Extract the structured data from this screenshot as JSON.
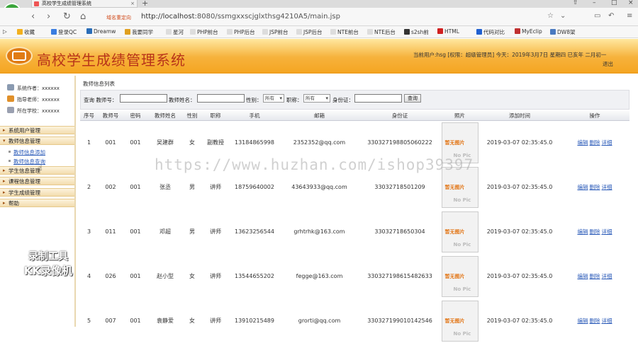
{
  "browser": {
    "tab_title": "高校学生成绩管理系统",
    "url_badge": "域名重定向",
    "url_host": "http://localhost",
    "url_path": ":8080/ssmgxxscjglxthsg4210A5/main.jsp",
    "bookmarks": [
      {
        "label": "收藏",
        "color": "#f2b01e"
      },
      {
        "label": "登录QC",
        "color": "#3a7de0"
      },
      {
        "label": "Dreamw",
        "color": "#2a6db8"
      },
      {
        "label": "我要同学",
        "color": "#e0a020"
      },
      {
        "label": "星河",
        "color": "#dddddd"
      },
      {
        "label": "PHP前台",
        "color": "#dddddd"
      },
      {
        "label": "PHP后台",
        "color": "#dddddd"
      },
      {
        "label": "JSP前台",
        "color": "#dddddd"
      },
      {
        "label": "JSP后台",
        "color": "#dddddd"
      },
      {
        "label": "NTE前台",
        "color": "#dddddd"
      },
      {
        "label": "NTE后台",
        "color": "#dddddd"
      },
      {
        "label": "s2sh前",
        "color": "#333333"
      },
      {
        "label": "HTML",
        "color": "#d02020"
      },
      {
        "label": "代码对比",
        "color": "#2060d0"
      },
      {
        "label": "MyEclip",
        "color": "#c03030"
      },
      {
        "label": "DW8架",
        "color": "#4a7ac0"
      }
    ]
  },
  "header": {
    "title": "高校学生成绩管理系统",
    "status": "当前用户:hsg [权限：超级管理员] 今天：2019年3月7日 星期四 已亥年 二月初一",
    "logout": "退出"
  },
  "sidebar": {
    "info": [
      {
        "label": "系统作者：xxxxxx",
        "color": "#8a9ab0"
      },
      {
        "label": "指导老师：xxxxxx",
        "color": "#e0902a"
      },
      {
        "label": "所在学校：xxxxxx",
        "color": "#9aa0b0"
      }
    ],
    "menus": {
      "m1": "系统用户管理",
      "m2": "教师信息管理",
      "m3": "学生信息管理",
      "m4": "课程信息管理",
      "m5": "学生成绩管理",
      "m6": "帮助"
    },
    "sub1": "教师信息添加",
    "sub2": "教师信息查询"
  },
  "main": {
    "panel_title": "教师信息列表",
    "search": {
      "label_teacher_no": "查询 教师号：",
      "label_name": "教师姓名：",
      "label_gender": "性别：",
      "gender_value": "所有",
      "label_title": "职称：",
      "title_value": "所有",
      "label_id": "身份证：",
      "button": "查询"
    },
    "columns": [
      "序号",
      "教师号",
      "密码",
      "教师姓名",
      "性别",
      "职称",
      "手机",
      "邮箱",
      "身份证",
      "照片",
      "添加时间",
      "操作"
    ],
    "rows": [
      {
        "idx": "1",
        "no": "001",
        "pwd": "001",
        "name": "吴建群",
        "gender": "女",
        "title": "副教授",
        "phone": "13184865998",
        "email": "2352352@qq.com",
        "idcard": "330327198805060222",
        "time": "2019-03-07 02:35:45.0"
      },
      {
        "idx": "2",
        "no": "002",
        "pwd": "001",
        "name": "张丞",
        "gender": "男",
        "title": "讲师",
        "phone": "18759640002",
        "email": "43643933@qq.com",
        "idcard": "33032718501209",
        "time": "2019-03-07 02:35:45.0"
      },
      {
        "idx": "3",
        "no": "011",
        "pwd": "001",
        "name": "邓超",
        "gender": "男",
        "title": "讲师",
        "phone": "13623256544",
        "email": "grhtrhk@163.com",
        "idcard": "33032718650304",
        "time": "2019-03-07 02:35:45.0"
      },
      {
        "idx": "4",
        "no": "026",
        "pwd": "001",
        "name": "赵小型",
        "gender": "女",
        "title": "讲师",
        "phone": "13544655202",
        "email": "fegge@163.com",
        "idcard": "330327198615482633",
        "time": "2019-03-07 02:35:45.0"
      },
      {
        "idx": "5",
        "no": "007",
        "pwd": "001",
        "name": "袁静爱",
        "gender": "女",
        "title": "讲师",
        "phone": "13910215489",
        "email": "grorti@qq.com",
        "idcard": "330327199010142546",
        "time": "2019-03-07 02:35:45.0"
      }
    ],
    "nopic_top": "暂无图片",
    "nopic_bottom": "No Pic",
    "ops": {
      "edit": "编辑",
      "delete": "删除",
      "detail": "详细"
    }
  },
  "overlay": {
    "watermark": "https://www.huzhan.com/ishop39397",
    "rec_line1": "录制工具",
    "rec_line2": "KK录像机"
  }
}
